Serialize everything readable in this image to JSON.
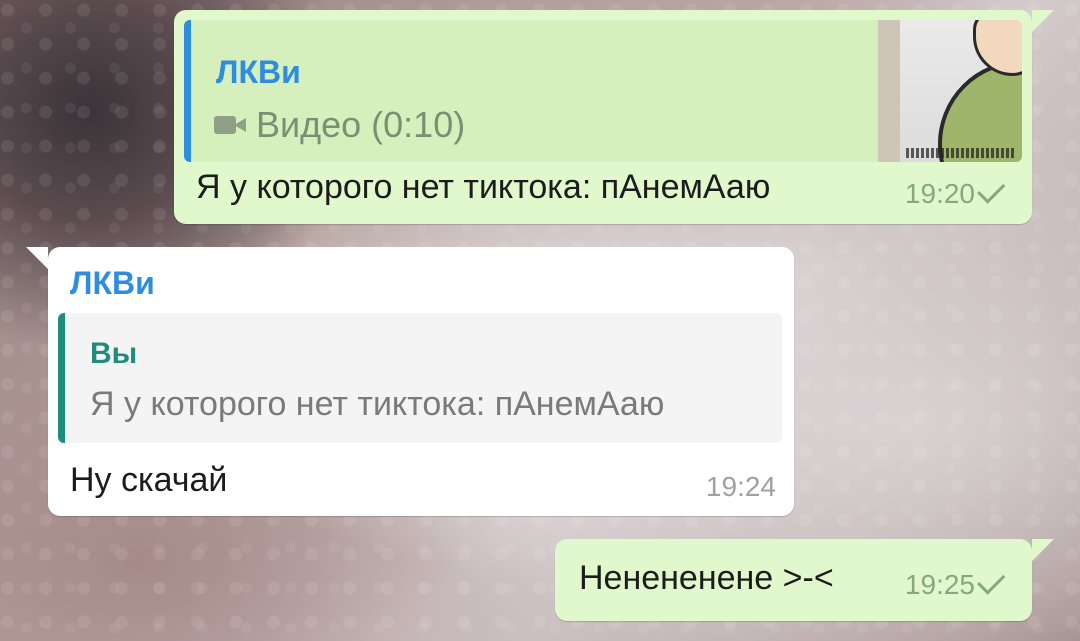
{
  "messages": [
    {
      "direction": "outgoing",
      "reply": {
        "author": "ЛКВи",
        "media_icon": "video-camera-icon",
        "preview": "Видео (0:10)"
      },
      "text": "Я у которого нет тиктока: пАнемАаю",
      "time": "19:20",
      "status_icon": "check-icon"
    },
    {
      "direction": "incoming",
      "sender": "ЛКВи",
      "reply": {
        "author": "Вы",
        "preview": "Я у которого нет тиктока: пАнемАаю"
      },
      "text": "Ну скачай",
      "time": "19:24"
    },
    {
      "direction": "outgoing",
      "text": "Нененененe >-<",
      "time": "19:25",
      "status_icon": "check-icon"
    }
  ],
  "colors": {
    "outgoing_bubble": "#e1f8cc",
    "incoming_bubble": "#ffffff",
    "sender_name": "#2f8de0",
    "reply_self": "#1f8c7e"
  }
}
